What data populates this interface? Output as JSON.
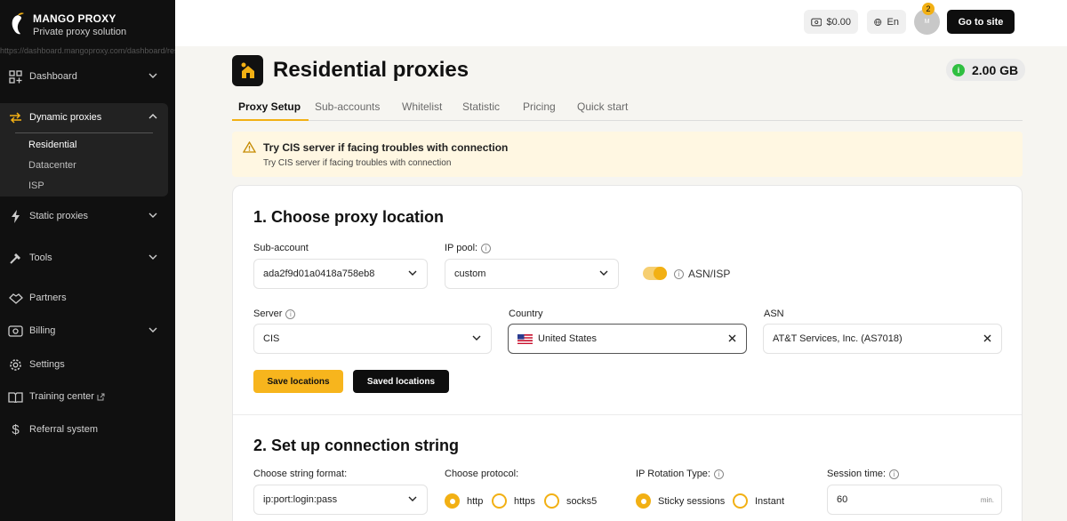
{
  "brand": {
    "name": "MANGO PROXY",
    "tagline": "Private proxy solution",
    "overlay_url": "https://dashboard.mangoproxy.com/dashboard/residential/proxy-setup"
  },
  "sidebar": {
    "dashboard": "Dashboard",
    "dynamic": "Dynamic proxies",
    "sub": [
      "Residential",
      "Datacenter",
      "ISP"
    ],
    "static": "Static proxies",
    "tools": "Tools",
    "partners": "Partners",
    "billing": "Billing",
    "settings": "Settings",
    "training": "Training center",
    "referral": "Referral system"
  },
  "topbar": {
    "balance": "$0.00",
    "language": "En",
    "avatar": "M",
    "notifications": "2",
    "go_site": "Go to site"
  },
  "page": {
    "title": "Residential proxies",
    "traffic": "2.00 GB",
    "traffic_icon": "i"
  },
  "tabs": [
    "Proxy Setup",
    "Sub-accounts",
    "Whitelist",
    "Statistic",
    "Pricing",
    "Quick start"
  ],
  "alert": {
    "title": "Try CIS server if facing troubles with connection",
    "text": "Try CIS server if facing troubles with connection"
  },
  "location": {
    "title": "1. Choose proxy location",
    "subaccount_label": "Sub-account",
    "subaccount_value": "ada2f9d01a0418a758eb8",
    "pool_label": "IP pool:",
    "pool_value": "custom",
    "asn_toggle_label": "ASN/ISP",
    "server_label": "Server",
    "server_value": "CIS",
    "country_label": "Country",
    "country_value": "United States",
    "asn_label": "ASN",
    "asn_value": "AT&T Services, Inc. (AS7018)",
    "save_btn": "Save locations",
    "saved_btn": "Saved locations"
  },
  "connection": {
    "title": "2. Set up connection string",
    "format_label": "Choose string format:",
    "format_value": "ip:port:login:pass",
    "protocol_label": "Choose protocol:",
    "protocols": [
      "http",
      "https",
      "socks5"
    ],
    "rotation_label": "IP Rotation Type:",
    "rotations": [
      "Sticky sessions",
      "Instant"
    ],
    "session_label": "Session time:",
    "session_value": "60",
    "session_unit": "min."
  },
  "colors": {
    "accent": "#f2b014",
    "sidebar": "#101010",
    "success": "#2fbf41"
  }
}
